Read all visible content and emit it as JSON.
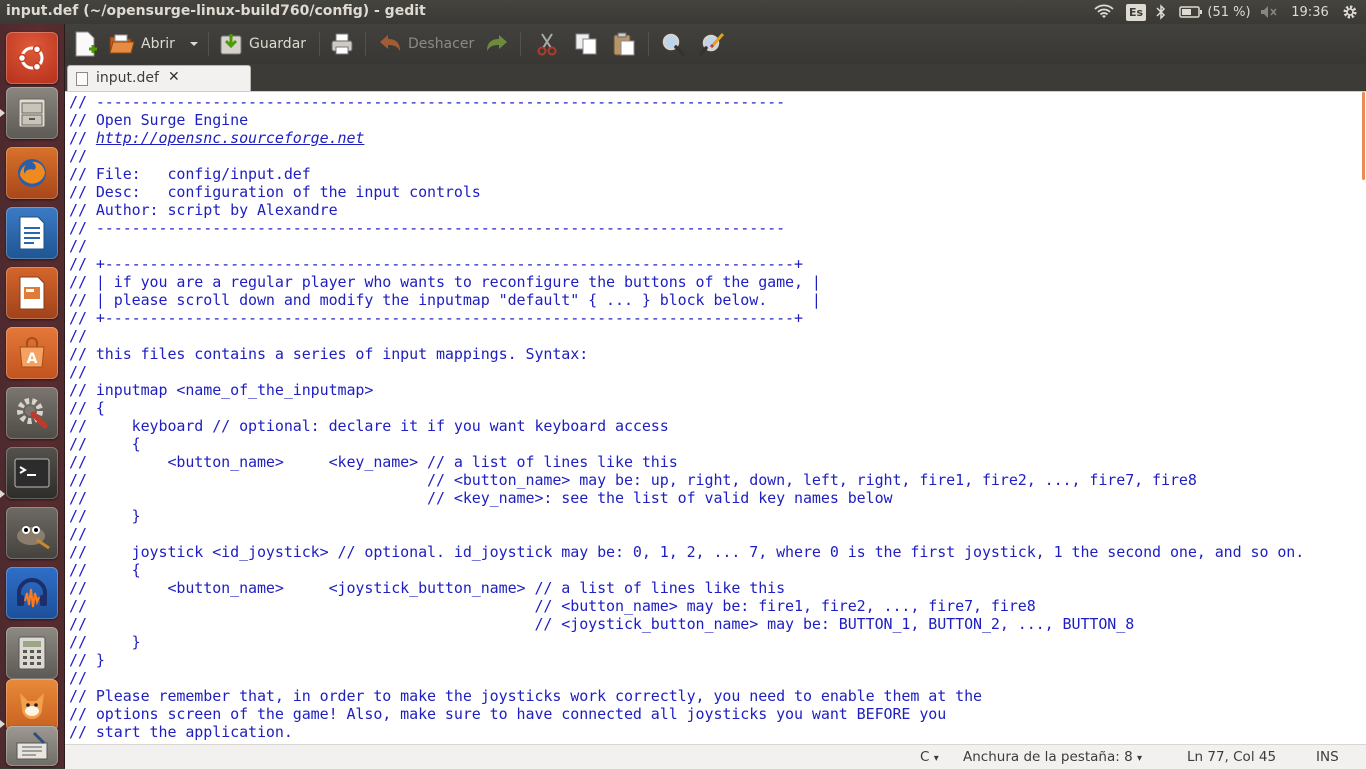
{
  "window": {
    "title": "input.def (~/opensurge-linux-build760/config) - gedit"
  },
  "tray": {
    "keyboard_layout": "Es",
    "battery": "(51 %)",
    "clock": "19:36"
  },
  "toolbar": {
    "open_label": "Abrir",
    "save_label": "Guardar",
    "undo_label": "Deshacer"
  },
  "tab": {
    "name": "input.def",
    "close": "✕"
  },
  "editor": {
    "lines": [
      "// -----------------------------------------------------------------------------",
      "// Open Surge Engine",
      "// ",
      "//",
      "// File:   config/input.def",
      "// Desc:   configuration of the input controls",
      "// Author: script by Alexandre",
      "// -----------------------------------------------------------------------------",
      "//",
      "// +-----------------------------------------------------------------------------+",
      "// | if you are a regular player who wants to reconfigure the buttons of the game, |",
      "// | please scroll down and modify the inputmap \"default\" { ... } block below.     |",
      "// +-----------------------------------------------------------------------------+",
      "//",
      "// this files contains a series of input mappings. Syntax:",
      "//",
      "// inputmap <name_of_the_inputmap>",
      "// {",
      "//     keyboard // optional: declare it if you want keyboard access",
      "//     {",
      "//         <button_name>     <key_name> // a list of lines like this",
      "//                                      // <button_name> may be: up, right, down, left, right, fire1, fire2, ..., fire7, fire8",
      "//                                      // <key_name>: see the list of valid key names below",
      "//     }",
      "//",
      "//     joystick <id_joystick> // optional. id_joystick may be: 0, 1, 2, ... 7, where 0 is the first joystick, 1 the second one, and so on.",
      "//     {",
      "//         <button_name>     <joystick_button_name> // a list of lines like this",
      "//                                                  // <button_name> may be: fire1, fire2, ..., fire7, fire8",
      "//                                                  // <joystick_button_name> may be: BUTTON_1, BUTTON_2, ..., BUTTON_8",
      "//     }",
      "// }",
      "//",
      "// Please remember that, in order to make the joysticks work correctly, you need to enable them at the",
      "// options screen of the game! Also, make sure to have connected all joysticks you want BEFORE you",
      "// start the application."
    ],
    "link": "http://opensnc.sourceforge.net"
  },
  "statusbar": {
    "language": "C",
    "tab_width": "Anchura de la pestaña: 8",
    "position": "Ln 77, Col 45",
    "mode": "INS"
  }
}
